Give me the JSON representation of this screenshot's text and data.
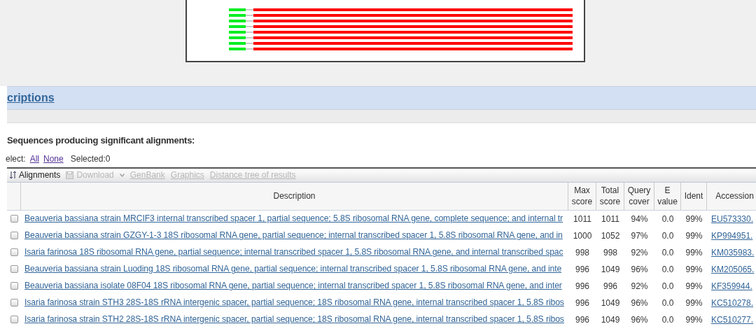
{
  "section_title": "criptions",
  "heading": "Sequences producing significant alignments:",
  "select_bar": {
    "label": "elect:",
    "links": [
      "All",
      "None"
    ],
    "selected_count": "Selected:0"
  },
  "toolbar": {
    "items": [
      {
        "label": "Alignments",
        "kind": "icon-link",
        "disabled": false
      },
      {
        "label": "Download",
        "kind": "dropdown",
        "disabled": true
      },
      {
        "label": "GenBank",
        "kind": "link",
        "disabled": true
      },
      {
        "label": "Graphics",
        "kind": "link",
        "disabled": true
      },
      {
        "label": "Distance tree of results",
        "kind": "link",
        "disabled": true
      }
    ]
  },
  "table": {
    "columns": [
      [
        "Description"
      ],
      [
        "Max",
        "score"
      ],
      [
        "Total",
        "score"
      ],
      [
        "Query",
        "cover"
      ],
      [
        "E",
        "value"
      ],
      [
        "Ident"
      ],
      [
        "Accession"
      ]
    ],
    "rows": [
      {
        "checked": false,
        "description": "Beauveria bassiana strain MRCIF3 internal transcribed spacer 1, partial sequence; 5.8S ribosomal RNA gene, complete sequence; and internal tr",
        "max_score": "1011",
        "total_score": "1011",
        "query_cover": "94%",
        "e_value": "0.0",
        "ident": "99%",
        "accession": "EU573330."
      },
      {
        "checked": false,
        "description": "Beauveria bassiana strain GZGY-1-3 18S ribosomal RNA gene, partial sequence; internal transcribed spacer 1, 5.8S ribosomal RNA gene, and in",
        "max_score": "1000",
        "total_score": "1052",
        "query_cover": "97%",
        "e_value": "0.0",
        "ident": "99%",
        "accession": "KP994951."
      },
      {
        "checked": false,
        "description": "Isaria farinosa 18S ribosomal RNA gene, partial sequence; internal transcribed spacer 1, 5.8S ribosomal RNA gene, and internal transcribed spac",
        "max_score": "998",
        "total_score": "998",
        "query_cover": "92%",
        "e_value": "0.0",
        "ident": "99%",
        "accession": "KM035983."
      },
      {
        "checked": false,
        "description": "Beauveria bassiana strain Luoding 18S ribosomal RNA gene, partial sequence; internal transcribed spacer 1, 5.8S ribosomal RNA gene, and inte",
        "max_score": "996",
        "total_score": "1049",
        "query_cover": "96%",
        "e_value": "0.0",
        "ident": "99%",
        "accession": "KM205065."
      },
      {
        "checked": false,
        "description": "Beauveria bassiana isolate 08F04 18S ribosomal RNA gene, partial sequence; internal transcribed spacer 1, 5.8S ribosomal RNA gene, and inter",
        "max_score": "996",
        "total_score": "996",
        "query_cover": "92%",
        "e_value": "0.0",
        "ident": "99%",
        "accession": "KF359944."
      },
      {
        "checked": false,
        "description": "Isaria farinosa strain STH3 28S-18S rRNA intergenic spacer, partial sequence; 18S ribosomal RNA gene, internal transcribed spacer 1, 5.8S ribos",
        "max_score": "996",
        "total_score": "1049",
        "query_cover": "96%",
        "e_value": "0.0",
        "ident": "99%",
        "accession": "KC510278."
      },
      {
        "checked": false,
        "description": "Isaria farinosa strain STH2 28S-18S rRNA intergenic spacer, partial sequence; 18S ribosomal RNA gene, internal transcribed spacer 1, 5.8S ribos",
        "max_score": "996",
        "total_score": "1049",
        "query_cover": "96%",
        "e_value": "0.0",
        "ident": "99%",
        "accession": "KC510277."
      }
    ]
  }
}
